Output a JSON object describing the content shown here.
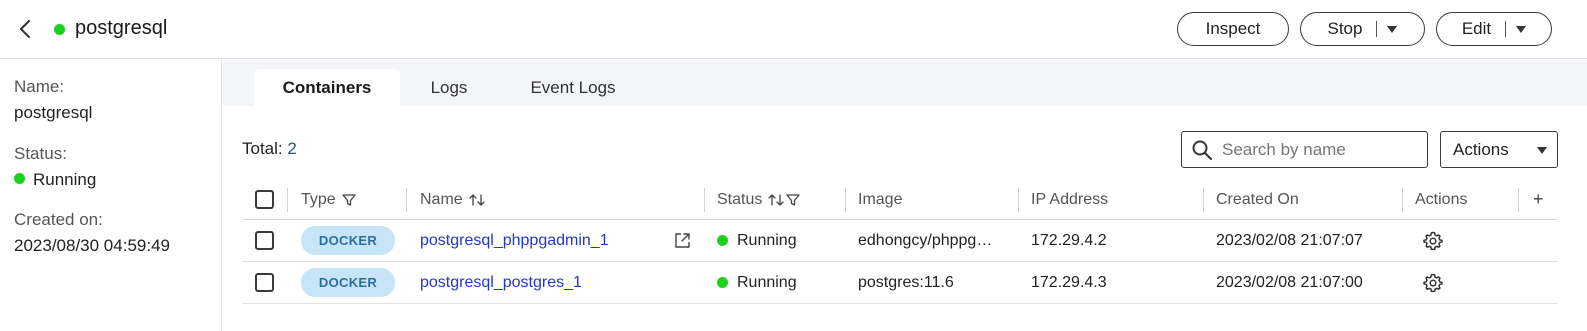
{
  "header": {
    "title": "postgresql",
    "status_color": "#1ed01e",
    "buttons": {
      "inspect": "Inspect",
      "stop": "Stop",
      "edit": "Edit"
    }
  },
  "left": {
    "name_label": "Name:",
    "name_value": "postgresql",
    "status_label": "Status:",
    "status_value": "Running",
    "created_label": "Created on:",
    "created_value": "2023/08/30 04:59:49"
  },
  "tabs": [
    {
      "label": "Containers",
      "active": true
    },
    {
      "label": "Logs",
      "active": false
    },
    {
      "label": "Event Logs",
      "active": false
    }
  ],
  "toolbar": {
    "total_label": "Total:",
    "total_value": "2",
    "search_placeholder": "Search by name",
    "actions_label": "Actions"
  },
  "table": {
    "columns": [
      "Type",
      "Name",
      "Status",
      "Image",
      "IP Address",
      "Created On",
      "Actions",
      "+"
    ],
    "rows": [
      {
        "type": "DOCKER",
        "name": "postgresql_phppgadmin_1",
        "status": "Running",
        "image": "edhongcy/phppg…",
        "ip": "172.29.4.2",
        "created": "2023/02/08 21:07:07"
      },
      {
        "type": "DOCKER",
        "name": "postgresql_postgres_1",
        "status": "Running",
        "image": "postgres:11.6",
        "ip": "172.29.4.3",
        "created": "2023/02/08 21:07:00"
      }
    ]
  },
  "colors": {
    "running": "#1ed01e",
    "link": "#2238c9",
    "badge_bg": "#c7e5f7",
    "badge_text": "#2a6fa0"
  }
}
